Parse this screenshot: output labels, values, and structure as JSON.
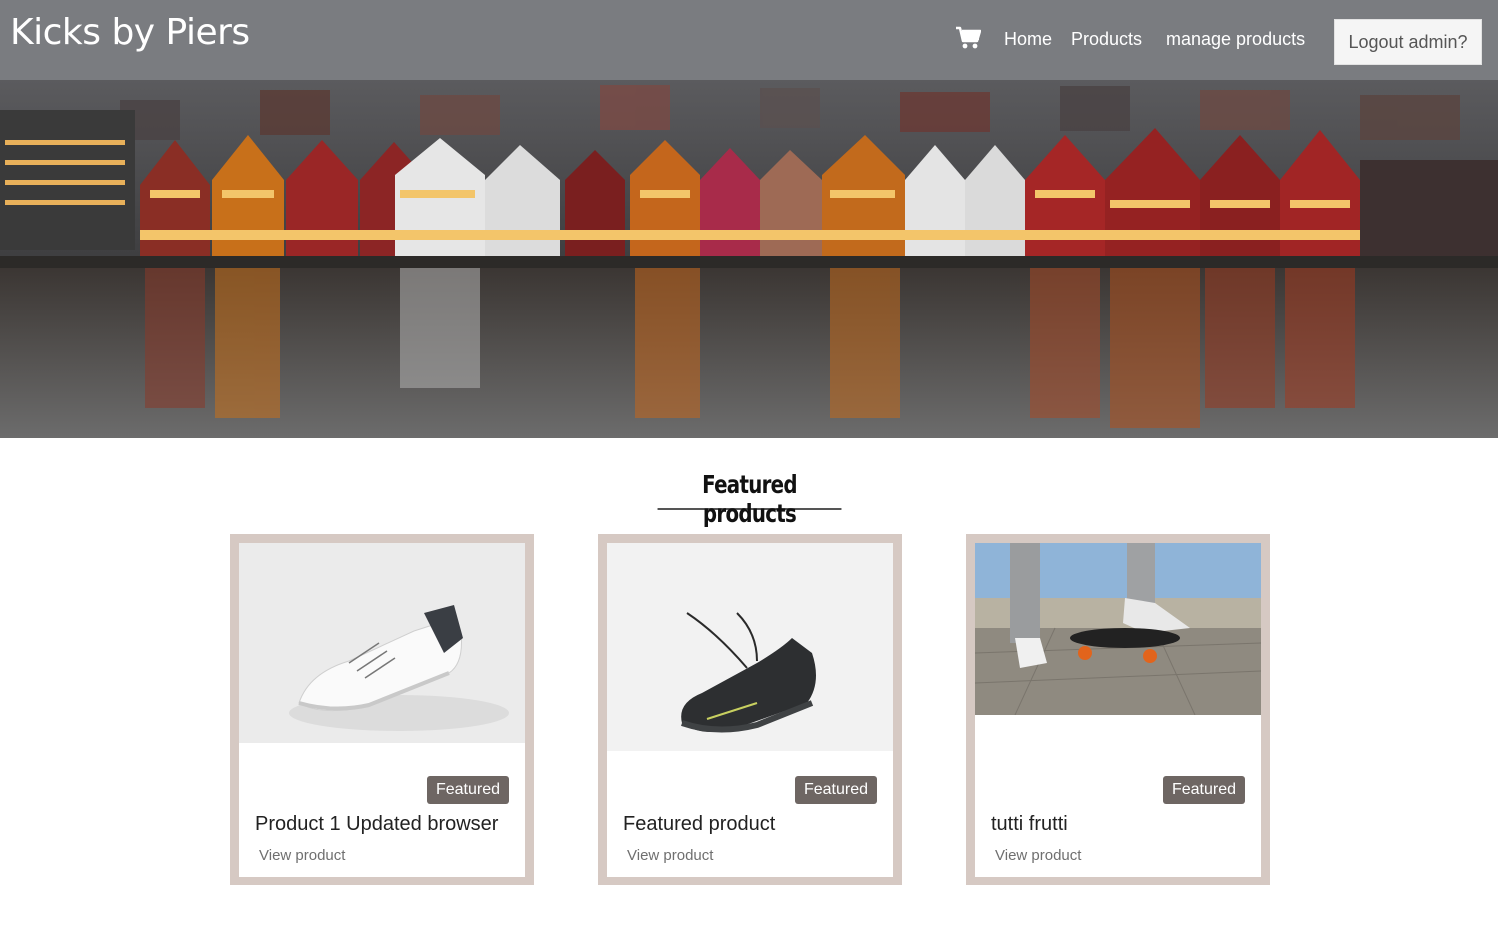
{
  "brand": {
    "name": "Kicks by Piers"
  },
  "nav": {
    "cart_icon": "shopping-cart-icon",
    "home": "Home",
    "products": "Products",
    "manage": "manage products",
    "logout": "Logout admin?"
  },
  "colors": {
    "navbar": "#7a7c80",
    "card_border": "#d6c9c3",
    "badge": "#6e6663"
  },
  "featured": {
    "title": "Featured products",
    "cards": [
      {
        "badge": "Featured",
        "title": "Product 1 Updated browser",
        "link": "View product"
      },
      {
        "badge": "Featured",
        "title": "Featured product",
        "link": "View product"
      },
      {
        "badge": "Featured",
        "title": "tutti frutti",
        "link": "View product"
      }
    ]
  }
}
